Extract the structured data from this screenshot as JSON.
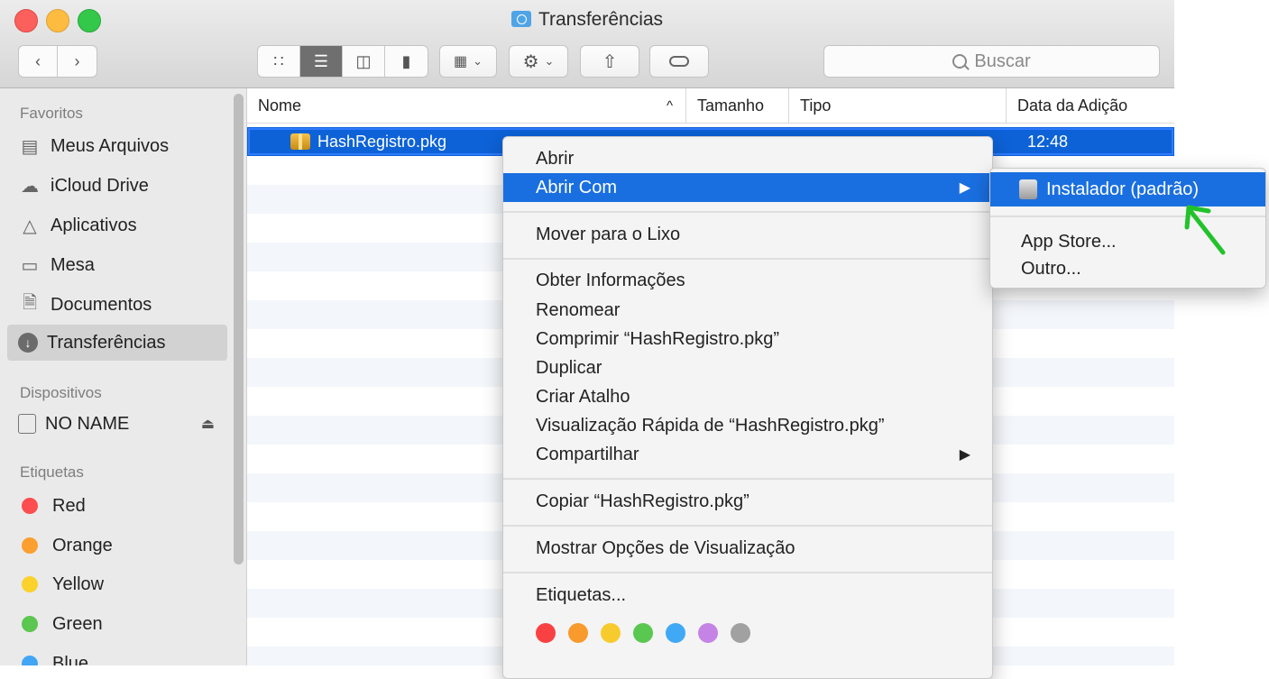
{
  "window": {
    "title": "Transferências"
  },
  "toolbar": {
    "back_icon": "chevron-left-icon",
    "forward_icon": "chevron-right-icon",
    "search_placeholder": "Buscar"
  },
  "sidebar": {
    "favorites_header": "Favoritos",
    "favorites": [
      {
        "label": "Meus Arquivos",
        "icon": "all-files-icon"
      },
      {
        "label": "iCloud Drive",
        "icon": "cloud-icon"
      },
      {
        "label": "Aplicativos",
        "icon": "applications-icon"
      },
      {
        "label": "Mesa",
        "icon": "desktop-icon"
      },
      {
        "label": "Documentos",
        "icon": "document-icon"
      },
      {
        "label": "Transferências",
        "icon": "download-icon"
      }
    ],
    "devices_header": "Dispositivos",
    "devices": [
      {
        "label": "NO NAME",
        "icon": "drive-icon"
      }
    ],
    "tags_header": "Etiquetas",
    "tags": [
      {
        "label": "Red",
        "color": "#fc4e4e"
      },
      {
        "label": "Orange",
        "color": "#fb9f2f"
      },
      {
        "label": "Yellow",
        "color": "#fbd12c"
      },
      {
        "label": "Green",
        "color": "#5bc650"
      },
      {
        "label": "Blue",
        "color": "#41a6f5"
      }
    ]
  },
  "list": {
    "columns": {
      "name": "Nome",
      "size": "Tamanho",
      "kind": "Tipo",
      "date_added": "Data da Adição"
    },
    "sort_indicator": "^",
    "rows": [
      {
        "name": "HashRegistro.pkg",
        "date_added": "12:48"
      }
    ]
  },
  "context_menu": {
    "items": {
      "open": "Abrir",
      "open_with": "Abrir Com",
      "move_to_trash": "Mover para o Lixo",
      "get_info": "Obter Informações",
      "rename": "Renomear",
      "compress": "Comprimir “HashRegistro.pkg”",
      "duplicate": "Duplicar",
      "make_alias": "Criar Atalho",
      "quick_look": "Visualização Rápida de “HashRegistro.pkg”",
      "share": "Compartilhar",
      "copy": "Copiar “HashRegistro.pkg”",
      "show_view_options": "Mostrar Opções de Visualização",
      "tags": "Etiquetas..."
    },
    "tag_colors": [
      "#f94144",
      "#f89a2c",
      "#f7cb2d",
      "#5ac850",
      "#3fa9f5",
      "#c583e5",
      "#a1a1a1"
    ]
  },
  "submenu": {
    "installer": "Instalador (padrão)",
    "app_store": "App Store...",
    "other": "Outro..."
  },
  "accent_color": "#1a6fe0"
}
